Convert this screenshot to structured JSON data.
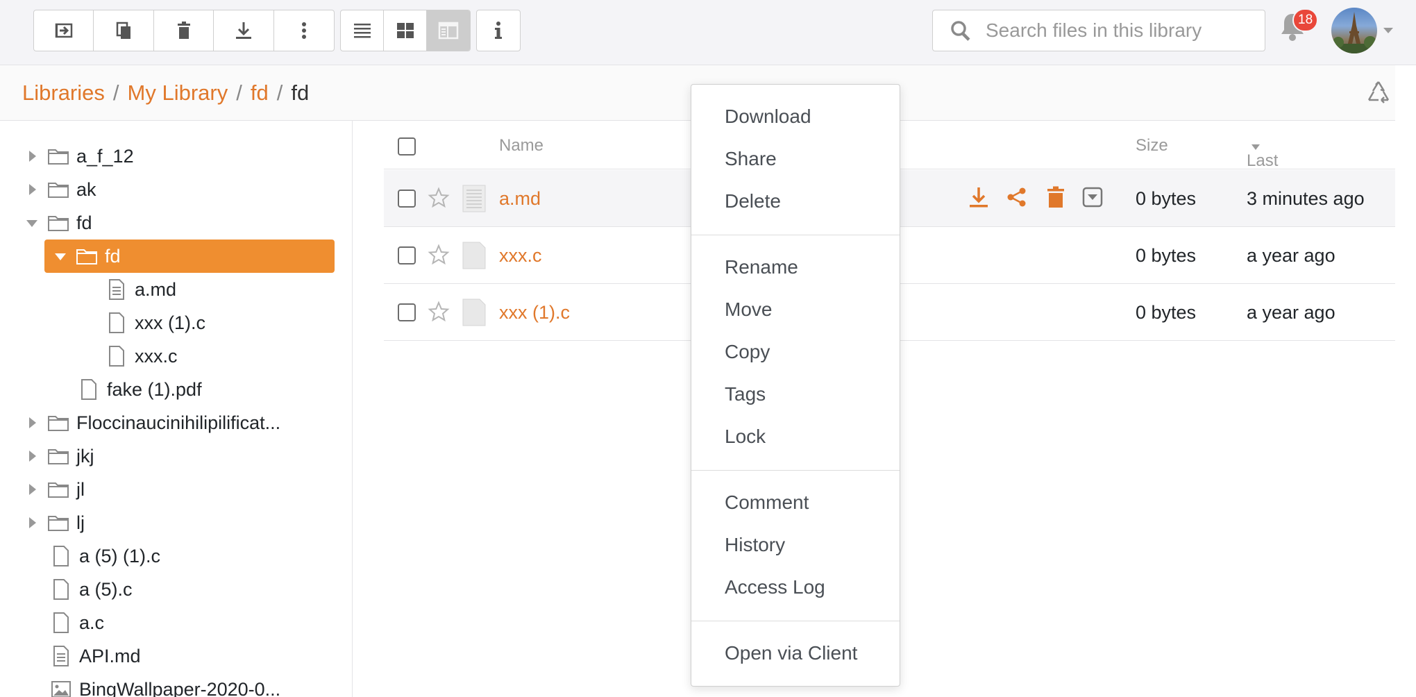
{
  "toolbar": {
    "actions": [
      "move-icon",
      "copy-icon",
      "delete-icon",
      "download-icon",
      "more-icon"
    ],
    "views": [
      "list-view-icon",
      "grid-view-icon",
      "column-view-icon"
    ],
    "info": "info-icon"
  },
  "search": {
    "placeholder": "Search files in this library"
  },
  "notifications": {
    "count": "18"
  },
  "breadcrumb": {
    "items": [
      "Libraries",
      "My Library",
      "fd"
    ],
    "current": "fd",
    "separator": "/"
  },
  "tree": {
    "items": [
      {
        "label": "a_f_12",
        "type": "folder"
      },
      {
        "label": "ak",
        "type": "folder"
      },
      {
        "label": "fd",
        "type": "folder",
        "expanded": true
      },
      {
        "label": "fd",
        "type": "folder",
        "expanded": true,
        "selected": true
      },
      {
        "label": "a.md",
        "type": "doc"
      },
      {
        "label": "xxx (1).c",
        "type": "file"
      },
      {
        "label": "xxx.c",
        "type": "file"
      },
      {
        "label": "fake (1).pdf",
        "type": "file"
      },
      {
        "label": "Floccinaucinihilipilificat...",
        "type": "folder"
      },
      {
        "label": "jkj",
        "type": "folder"
      },
      {
        "label": "jl",
        "type": "folder"
      },
      {
        "label": "lj",
        "type": "folder"
      },
      {
        "label": "a (5) (1).c",
        "type": "file"
      },
      {
        "label": "a (5).c",
        "type": "file"
      },
      {
        "label": "a.c",
        "type": "file"
      },
      {
        "label": "API.md",
        "type": "doc"
      },
      {
        "label": "BingWallpaper-2020-0...",
        "type": "image"
      }
    ]
  },
  "list": {
    "headers": {
      "name": "Name",
      "size": "Size",
      "updated": "Last Update"
    },
    "rows": [
      {
        "name": "a.md",
        "size": "0 bytes",
        "updated": "3 minutes ago"
      },
      {
        "name": "xxx.c",
        "size": "0 bytes",
        "updated": "a year ago"
      },
      {
        "name": "xxx (1).c",
        "size": "0 bytes",
        "updated": "a year ago"
      }
    ]
  },
  "menu": {
    "items": [
      "Download",
      "Share",
      "Delete",
      "Rename",
      "Move",
      "Copy",
      "Tags",
      "Lock",
      "Comment",
      "History",
      "Access Log",
      "Open via Client"
    ]
  },
  "colors": {
    "accent": "#e0782b",
    "selected": "#ef8e30",
    "badge": "#e9473a"
  }
}
